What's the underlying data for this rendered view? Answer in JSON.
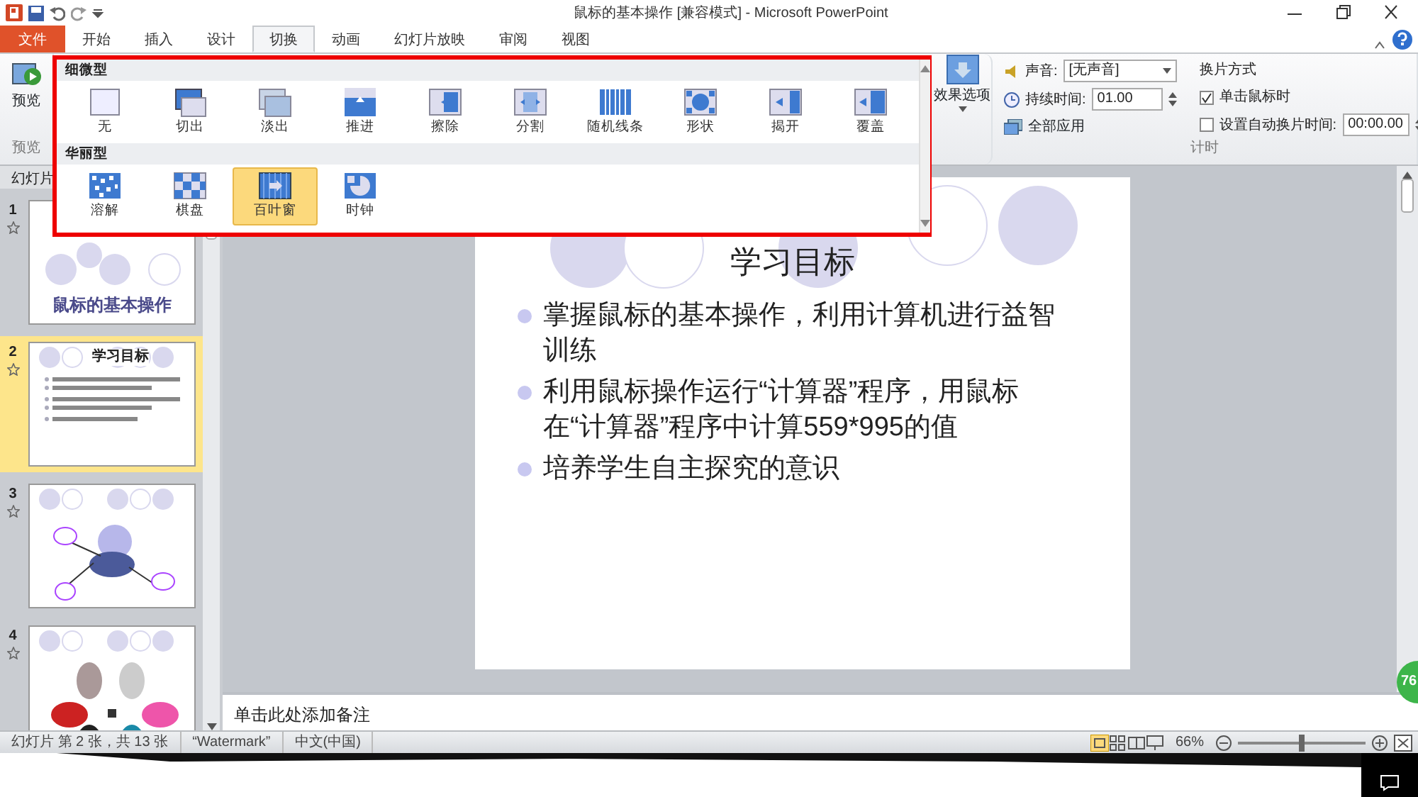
{
  "window": {
    "title": "鼠标的基本操作 [兼容模式] - Microsoft PowerPoint"
  },
  "ribbon_tabs": [
    {
      "label": "文件",
      "kind": "file",
      "selected": false
    },
    {
      "label": "开始",
      "kind": "tab",
      "selected": false
    },
    {
      "label": "插入",
      "kind": "tab",
      "selected": false
    },
    {
      "label": "设计",
      "kind": "tab",
      "selected": false
    },
    {
      "label": "切换",
      "kind": "tab",
      "selected": true
    },
    {
      "label": "动画",
      "kind": "tab",
      "selected": false
    },
    {
      "label": "幻灯片放映",
      "kind": "tab",
      "selected": false
    },
    {
      "label": "审阅",
      "kind": "tab",
      "selected": false
    },
    {
      "label": "视图",
      "kind": "tab",
      "selected": false
    }
  ],
  "preview_group": {
    "button": "预览",
    "label": "预览"
  },
  "transition_gallery": {
    "sections": [
      {
        "title": "细微型",
        "items": [
          {
            "label": "无",
            "selected": false
          },
          {
            "label": "切出",
            "selected": false
          },
          {
            "label": "淡出",
            "selected": false
          },
          {
            "label": "推进",
            "selected": false
          },
          {
            "label": "擦除",
            "selected": false
          },
          {
            "label": "分割",
            "selected": false
          },
          {
            "label": "随机线条",
            "selected": false
          },
          {
            "label": "形状",
            "selected": false
          },
          {
            "label": "揭开",
            "selected": false
          },
          {
            "label": "覆盖",
            "selected": false
          }
        ]
      },
      {
        "title": "华丽型",
        "items": [
          {
            "label": "溶解",
            "selected": false
          },
          {
            "label": "棋盘",
            "selected": false
          },
          {
            "label": "百叶窗",
            "selected": true
          },
          {
            "label": "时钟",
            "selected": false
          }
        ]
      }
    ]
  },
  "effect_options": {
    "label": "效果选项"
  },
  "timing": {
    "sound_label": "声音:",
    "sound_value": "[无声音]",
    "duration_label": "持续时间:",
    "duration_value": "01.00",
    "apply_all": "全部应用",
    "advance_title": "换片方式",
    "on_click": {
      "label": "单击鼠标时",
      "checked": true
    },
    "auto": {
      "label": "设置自动换片时间:",
      "checked": false,
      "value": "00:00.00"
    },
    "group_label": "计时"
  },
  "slides_pane": {
    "tab": "幻灯片",
    "thumbnails": [
      {
        "number": "1",
        "kind": "title",
        "title": "鼠标的基本操作",
        "selected": false
      },
      {
        "number": "2",
        "kind": "bullets",
        "title": "学习目标",
        "selected": true
      },
      {
        "number": "3",
        "kind": "cartoon",
        "selected": false
      },
      {
        "number": "4",
        "kind": "picture",
        "selected": false
      }
    ]
  },
  "slide": {
    "title": "学习目标",
    "bullets": [
      "掌握鼠标的基本操作，利用计算机进行益智训练",
      "利用鼠标操作运行“计算器”程序，用鼠标在“计算器”程序中计算559*995的值",
      "培养学生自主探究的意识"
    ]
  },
  "notes": {
    "prompt": "单击此处添加备注"
  },
  "status_bar": {
    "slide_info": "幻灯片 第 2 张，共 13 张",
    "theme": "“Watermark”",
    "language": "中文(中国)",
    "zoom": "66%",
    "zoom_slider": {
      "level": 0.5
    }
  },
  "floating_badge": "76"
}
